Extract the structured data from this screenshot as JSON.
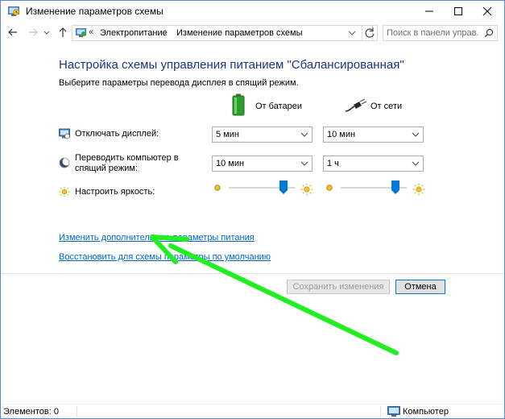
{
  "window": {
    "title": "Изменение параметров схемы",
    "controls": {
      "minimize": "minimize-icon",
      "maximize": "maximize-icon",
      "close": "close-icon"
    }
  },
  "navigation": {
    "back_icon": "arrow-left-icon",
    "forward_icon": "arrow-right-icon",
    "recent_icon": "chevron-down-icon",
    "up_icon": "arrow-up-icon",
    "breadcrumb": {
      "overflow": "«",
      "items": [
        "Электропитание",
        "Изменение параметров схемы"
      ],
      "separator": "›"
    },
    "refresh_icon": "refresh-icon",
    "search": {
      "placeholder": "Поиск в панели управ...",
      "icon": "search-icon"
    }
  },
  "content": {
    "heading": "Настройка схемы управления питанием \"Сбалансированная\"",
    "subheading": "Выберите параметры перевода дисплея в спящий режим.",
    "columns": {
      "battery": {
        "label": "От батареи",
        "icon": "battery-icon"
      },
      "plugged": {
        "label": "От сети",
        "icon": "power-plug-icon"
      }
    },
    "settings": [
      {
        "label": "Отключать дисплей:",
        "icon": "display-timer-icon",
        "battery": "5 мин",
        "plugged": "10 мин"
      },
      {
        "label": "Переводить компьютер в спящий режим:",
        "icon": "sleep-moon-icon",
        "battery": "10 мин",
        "plugged": "1 ч"
      }
    ],
    "brightness": {
      "label": "Настроить яркость:",
      "icon": "brightness-sun-icon",
      "battery_level": 0.88,
      "plugged_level": 0.88
    },
    "links": {
      "advanced": "Изменить дополнительные параметры питания",
      "restore": "Восстановить для схемы параметры по умолчанию"
    },
    "buttons": {
      "save": "Сохранить изменения",
      "cancel": "Отмена"
    },
    "annotation": {
      "type": "arrow",
      "color": "#22ee22"
    }
  },
  "statusbar": {
    "items": "Элементов: 0",
    "location": "Компьютер",
    "location_icon": "computer-icon"
  },
  "colors": {
    "heading": "#1e3287",
    "link": "#0066cc",
    "slider_thumb": "#0078d7",
    "window_border": "#5a8ad0",
    "annotation_arrow": "#22ee22"
  }
}
